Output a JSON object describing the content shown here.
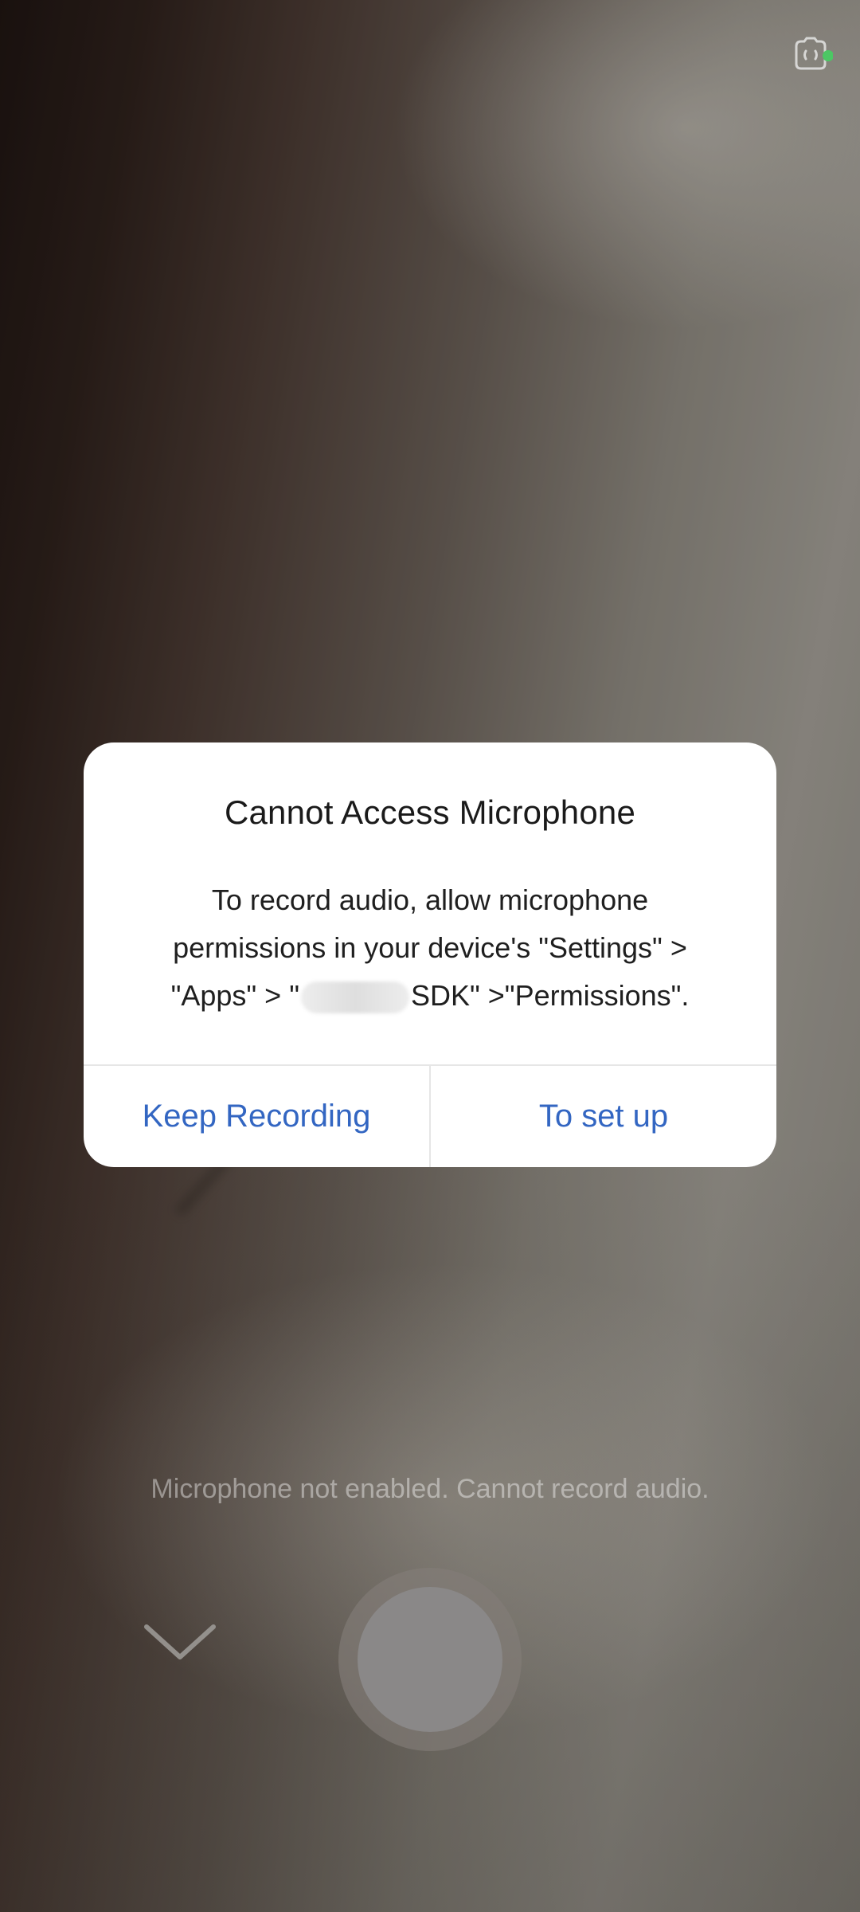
{
  "camera": {
    "top_icon": "camera-switch-icon",
    "status_dot_color": "#4cc764",
    "hint_text": "Microphone not enabled. Cannot record audio.",
    "collapse_icon": "chevron-down-icon",
    "shutter_icon": "record-button"
  },
  "dialog": {
    "title": "Cannot Access Microphone",
    "message_line1": "To record audio, allow microphone",
    "message_line2": "permissions in your device's \"Settings\" >",
    "message_line3_prefix": "\"Apps\" > \"",
    "message_line3_suffix": "SDK\" >\"Permissions\".",
    "keep_recording_label": "Keep Recording",
    "setup_label": "To set up",
    "accent_color": "#3366c2"
  }
}
